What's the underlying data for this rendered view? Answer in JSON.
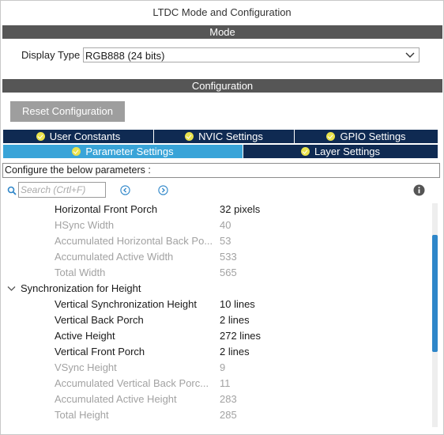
{
  "window": {
    "title": "LTDC Mode and Configuration"
  },
  "mode_section": {
    "header": "Mode",
    "display_type_label": "Display Type",
    "display_type_value": "RGB888 (24 bits)"
  },
  "config_section": {
    "header": "Configuration",
    "reset_button": "Reset Configuration",
    "tabs_row1": [
      {
        "label": "User Constants"
      },
      {
        "label": "NVIC Settings"
      },
      {
        "label": "GPIO Settings"
      }
    ],
    "tabs_row2": [
      {
        "label": "Parameter Settings",
        "active": true
      },
      {
        "label": "Layer Settings",
        "active": false
      }
    ],
    "info_text": "Configure the below parameters :",
    "search_placeholder": "Search (Crtl+F)"
  },
  "params": [
    {
      "name": "Horizontal Front Porch",
      "value": "32 pixels",
      "enabled": true
    },
    {
      "name": "HSync Width",
      "value": "40",
      "enabled": false
    },
    {
      "name": "Accumulated Horizontal Back Po...",
      "value": "53",
      "enabled": false
    },
    {
      "name": "Accumulated Active Width",
      "value": "533",
      "enabled": false
    },
    {
      "name": "Total Width",
      "value": "565",
      "enabled": false
    }
  ],
  "group_height": {
    "label": "Synchronization for Height"
  },
  "params_height": [
    {
      "name": "Vertical Synchronization Height",
      "value": "10 lines",
      "enabled": true
    },
    {
      "name": "Vertical Back Porch",
      "value": "2 lines",
      "enabled": true
    },
    {
      "name": "Active Height",
      "value": "272 lines",
      "enabled": true
    },
    {
      "name": "Vertical Front Porch",
      "value": "2 lines",
      "enabled": true
    },
    {
      "name": "VSync Height",
      "value": "9",
      "enabled": false
    },
    {
      "name": "Accumulated Vertical Back Porc...",
      "value": "11",
      "enabled": false
    },
    {
      "name": "Accumulated Active Height",
      "value": "283",
      "enabled": false
    },
    {
      "name": "Total Height",
      "value": "285",
      "enabled": false
    }
  ],
  "colors": {
    "accent": "#39a4d8",
    "tab_dark": "#0f2a52",
    "section_bar": "#565656",
    "scroll_thumb": "#2e86c9"
  }
}
